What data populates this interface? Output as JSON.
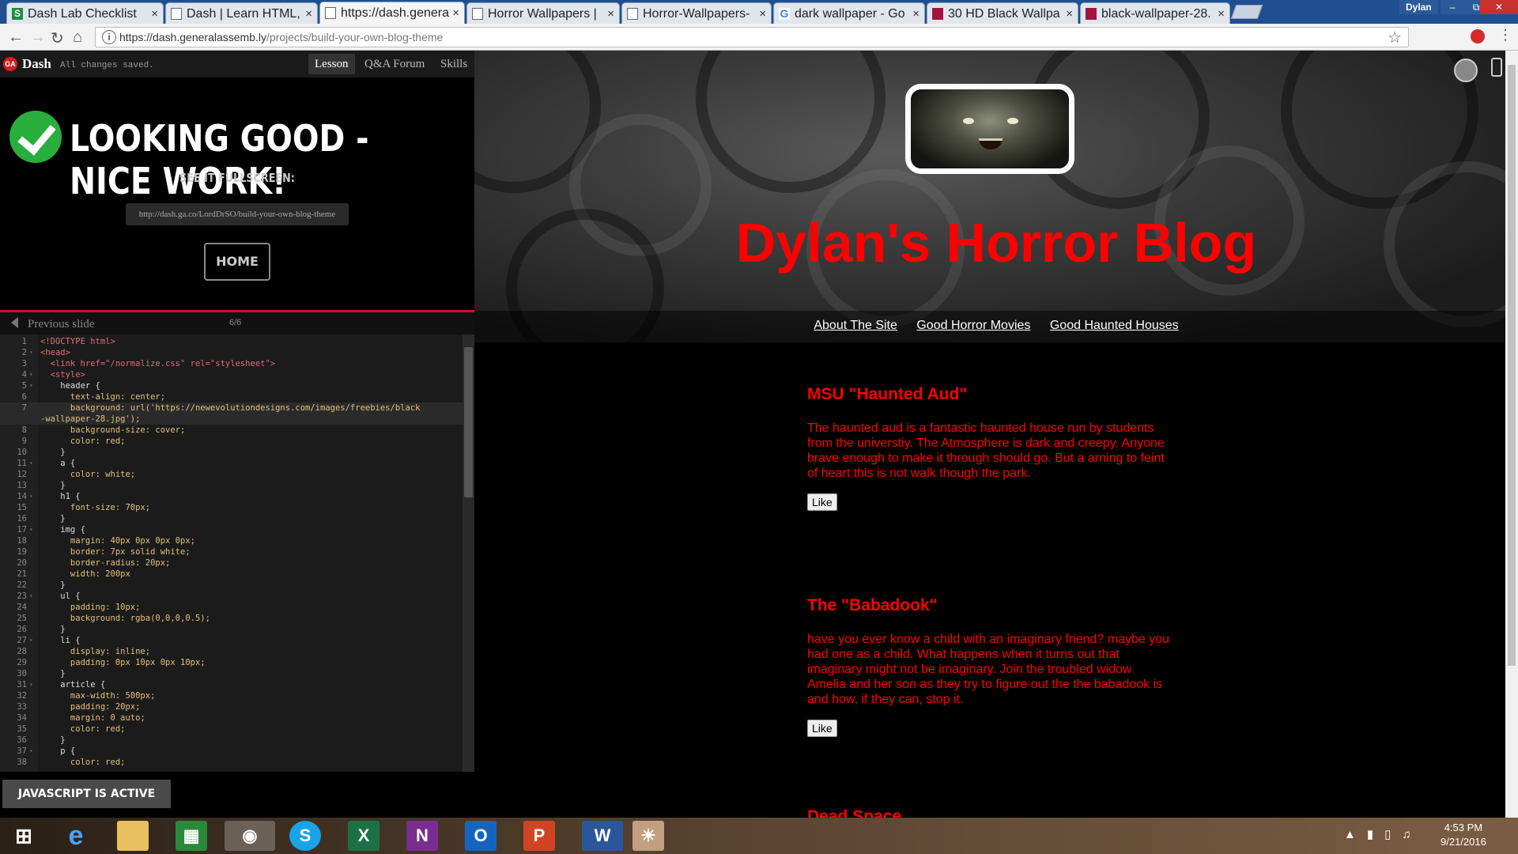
{
  "browser": {
    "tabs": [
      {
        "title": "Dash Lab Checklist",
        "icon": "sheets-icon"
      },
      {
        "title": "Dash | Learn HTML,",
        "icon": "page-icon"
      },
      {
        "title": "https://dash.genera",
        "icon": "page-icon"
      },
      {
        "title": "Horror Wallpapers |",
        "icon": "page-icon"
      },
      {
        "title": "Horror-Wallpapers-",
        "icon": "page-icon"
      },
      {
        "title": "dark wallpaper - Go",
        "icon": "google-icon"
      },
      {
        "title": "30 HD Black Wallpa",
        "icon": "site-icon"
      },
      {
        "title": "black-wallpaper-28.",
        "icon": "site-icon"
      }
    ],
    "user": "Dylan",
    "url_host": "https://dash.generalassemb.ly",
    "url_path": "/projects/build-your-own-blog-theme"
  },
  "dash": {
    "brand": "Dash",
    "logo_text": "GA",
    "saved_status": "All changes saved.",
    "tabs": [
      "Lesson",
      "Q&A Forum",
      "Skills"
    ],
    "success_title": "LOOKING GOOD - NICE WORK!",
    "fullscreen_label": "SEE IT FULLSCREEN:",
    "share_url": "http://dash.ga.co/LordDrSO/build-your-own-blog-theme",
    "home_label": "HOME",
    "prev_slide": "Previous slide",
    "slide_count": "6/6",
    "js_status": "JAVASCRIPT IS ACTIVE"
  },
  "code": [
    {
      "n": "1",
      "fold": false,
      "text": "<!DOCTYPE html>"
    },
    {
      "n": "2",
      "fold": true,
      "text": "<head>"
    },
    {
      "n": "3",
      "fold": false,
      "text": "  <link href=\"/normalize.css\" rel=\"stylesheet\">"
    },
    {
      "n": "4",
      "fold": true,
      "text": "  <style>"
    },
    {
      "n": "5",
      "fold": true,
      "text": "    header {"
    },
    {
      "n": "6",
      "fold": false,
      "text": "      text-align: center;"
    },
    {
      "n": "7",
      "fold": false,
      "text": "      background: url('https://newevolutiondesigns.com/images/freebies/black"
    },
    {
      "n": "",
      "fold": false,
      "text": "-wallpaper-28.jpg');"
    },
    {
      "n": "8",
      "fold": false,
      "text": "      background-size: cover;"
    },
    {
      "n": "9",
      "fold": false,
      "text": "      color: red;"
    },
    {
      "n": "10",
      "fold": false,
      "text": "    }"
    },
    {
      "n": "11",
      "fold": true,
      "text": "    a {"
    },
    {
      "n": "12",
      "fold": false,
      "text": "      color: white;"
    },
    {
      "n": "13",
      "fold": false,
      "text": "    }"
    },
    {
      "n": "14",
      "fold": true,
      "text": "    h1 {"
    },
    {
      "n": "15",
      "fold": false,
      "text": "      font-size: 70px;"
    },
    {
      "n": "16",
      "fold": false,
      "text": "    }"
    },
    {
      "n": "17",
      "fold": true,
      "text": "    img {"
    },
    {
      "n": "18",
      "fold": false,
      "text": "      margin: 40px 0px 0px 0px;"
    },
    {
      "n": "19",
      "fold": false,
      "text": "      border: 7px solid white;"
    },
    {
      "n": "20",
      "fold": false,
      "text": "      border-radius: 20px;"
    },
    {
      "n": "21",
      "fold": false,
      "text": "      width: 200px"
    },
    {
      "n": "22",
      "fold": false,
      "text": "    }"
    },
    {
      "n": "23",
      "fold": true,
      "text": "    ul {"
    },
    {
      "n": "24",
      "fold": false,
      "text": "      padding: 10px;"
    },
    {
      "n": "25",
      "fold": false,
      "text": "      background: rgba(0,0,0,0.5);"
    },
    {
      "n": "26",
      "fold": false,
      "text": "    }"
    },
    {
      "n": "27",
      "fold": true,
      "text": "    li {"
    },
    {
      "n": "28",
      "fold": false,
      "text": "      display: inline;"
    },
    {
      "n": "29",
      "fold": false,
      "text": "      padding: 0px 10px 0px 10px;"
    },
    {
      "n": "30",
      "fold": false,
      "text": "    }"
    },
    {
      "n": "31",
      "fold": true,
      "text": "    article {"
    },
    {
      "n": "32",
      "fold": false,
      "text": "      max-width: 500px;"
    },
    {
      "n": "33",
      "fold": false,
      "text": "      padding: 20px;"
    },
    {
      "n": "34",
      "fold": false,
      "text": "      margin: 0 auto;"
    },
    {
      "n": "35",
      "fold": false,
      "text": "      color: red;"
    },
    {
      "n": "36",
      "fold": false,
      "text": "    }"
    },
    {
      "n": "37",
      "fold": true,
      "text": "    p {"
    },
    {
      "n": "38",
      "fold": false,
      "text": "      color: red;"
    }
  ],
  "blog": {
    "title": "Dylan's Horror Blog",
    "nav": [
      "About The Site",
      "Good Horror Movies",
      "Good Haunted Houses"
    ],
    "articles": [
      {
        "title": "MSU \"Haunted Aud\"",
        "body": "The haunted aud is a fantastic haunted house run by students from the universtiy. The Atmosphere is dark and creepy. Anyone brave enough to make it through should go. But a arning to feint of heart this is not walk though the park.",
        "like": "Like"
      },
      {
        "title": "The \"Babadook\"",
        "body": "have you ever know a child with an imaginary friend? maybe you had one as a child. What happens when it turns out that imaginary might not be imaginary. Join the troubled widow Amelia and her son as they try to figure out the the babadook is and how, if they can, stop it.",
        "like": "Like"
      },
      {
        "title": "Dead Space",
        "body": "",
        "like": ""
      }
    ]
  },
  "taskbar": {
    "time": "4:53 PM",
    "date": "9/21/2016"
  },
  "colors": {
    "accent_red": "#ff0000",
    "dash_red": "#c8102e",
    "success_green": "#27ae3c"
  }
}
